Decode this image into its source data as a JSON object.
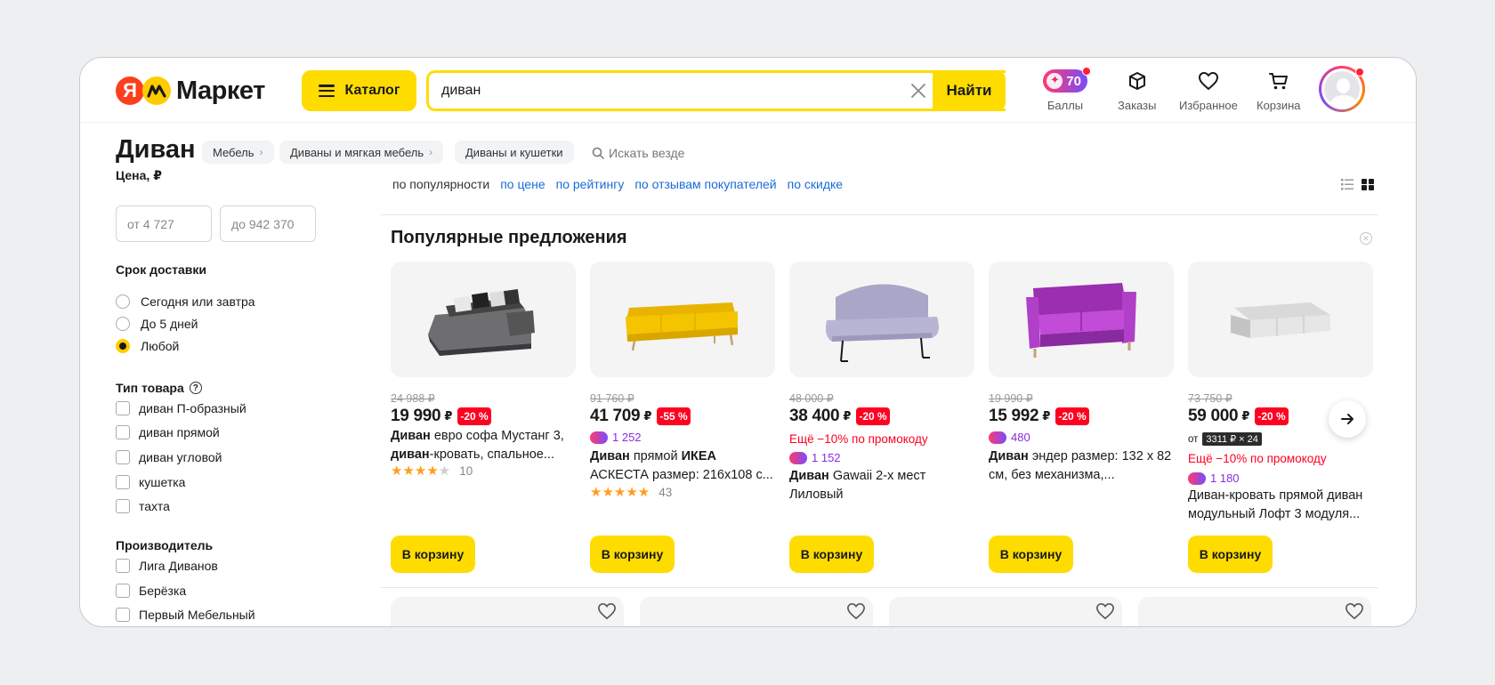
{
  "header": {
    "logo_ya": "Я",
    "logo_market": "Маркет",
    "catalog_label": "Каталог",
    "search_value": "диван",
    "search_button": "Найти",
    "points_value": "70",
    "points_label": "Баллы",
    "orders_label": "Заказы",
    "favorites_label": "Избранное",
    "cart_label": "Корзина"
  },
  "page": {
    "title": "Диван",
    "breadcrumbs": [
      "Мебель",
      "Диваны и мягкая мебель",
      "Диваны и кушетки"
    ],
    "search_everywhere": "Искать везде"
  },
  "filters": {
    "price_title": "Цена, ₽",
    "price_from": "от 4 727",
    "price_to": "до 942 370",
    "delivery_title": "Срок доставки",
    "delivery_options": [
      "Сегодня или завтра",
      "До 5 дней",
      "Любой"
    ],
    "delivery_selected": "Любой",
    "type_title": "Тип товара",
    "type_options": [
      "диван П-образный",
      "диван прямой",
      "диван угловой",
      "кушетка",
      "тахта"
    ],
    "maker_title": "Производитель",
    "maker_options": [
      "Лига Диванов",
      "Берёзка",
      "Первый Мебельный"
    ]
  },
  "sort": {
    "options": [
      "по популярности",
      "по цене",
      "по рейтингу",
      "по отзывам покупателей",
      "по скидке"
    ],
    "active": "по популярности"
  },
  "popular": {
    "title": "Популярные предложения",
    "cart_label": "В корзину",
    "products": [
      {
        "old_price": "24 988 ₽",
        "price": "19 990",
        "currency": "₽",
        "discount": "-20 %",
        "name_bold": "Диван",
        "name_rest": " евро софа Мустанг 3, ",
        "name_bold2": "диван",
        "name_rest2": "-кровать, спальное...",
        "rating": 4,
        "reviews": "10"
      },
      {
        "old_price": "91 760 ₽",
        "price": "41 709",
        "currency": "₽",
        "discount": "-55 %",
        "points": "1 252",
        "name_bold": "Диван",
        "name_rest": " прямой ",
        "name_bold2": "ИКЕА",
        "name_rest2": " АСКЕСТА размер: 216x108 с...",
        "rating": 5,
        "reviews": "43"
      },
      {
        "old_price": "48 000 ₽",
        "price": "38 400",
        "currency": "₽",
        "discount": "-20 %",
        "promo": "Ещё −10% по промокоду",
        "points": "1 152",
        "name_bold": "Диван",
        "name_rest": " Gawaii 2-х мест Лиловый"
      },
      {
        "old_price": "19 990 ₽",
        "price": "15 992",
        "currency": "₽",
        "discount": "-20 %",
        "points": "480",
        "name_bold": "Диван",
        "name_rest": " эндер размер: 132 х 82 см, без механизма,..."
      },
      {
        "old_price": "73 750 ₽",
        "price": "59 000",
        "currency": "₽",
        "discount": "-20 %",
        "installment_prefix": "от",
        "installment": "3311 ₽ × 24",
        "promo": "Ещё −10% по промокоду",
        "points": "1 180",
        "name_rest": "Диван-кровать прямой диван модульный Лофт 3 модуля..."
      }
    ]
  },
  "colors": {
    "accent_yellow": "#ffdc00",
    "discount_red": "#ff0021",
    "link_blue": "#1a6bd8",
    "points_purple": "#8a2be2"
  }
}
